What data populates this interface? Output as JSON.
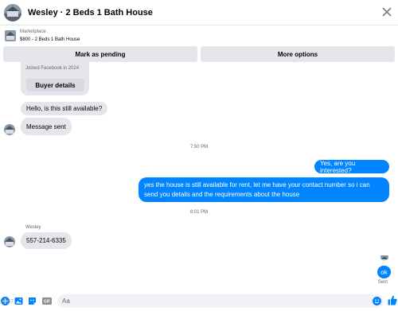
{
  "header": {
    "title": "Wesley · 2 Beds 1 Bath House",
    "close_icon": "close-icon"
  },
  "listing": {
    "source": "Marketplace",
    "price_title": "$800 - 2 Beds 1 Bath House"
  },
  "actions": {
    "mark_pending": "Mark as pending",
    "more_options": "More options"
  },
  "thread": {
    "profile_card": {
      "joined": "Joined Facebook in 2024",
      "buyer_details": "Buyer details"
    },
    "messages": [
      {
        "from": "buyer",
        "text": "Hello, is this still available?"
      },
      {
        "from": "buyer",
        "text": "Message sent"
      },
      {
        "from": "time",
        "text": "7:50 PM"
      },
      {
        "from": "me",
        "text": "Yes, are you interested?"
      },
      {
        "from": "me",
        "text": "yes the house is still available for rent, let me have your contact number so i can send you details and the requirements about the house"
      },
      {
        "from": "time",
        "text": "8:01 PM"
      },
      {
        "from": "buyer",
        "sender": "Wesley",
        "text": "557-214-6335"
      },
      {
        "from": "me",
        "text": "ok",
        "status": "Sent"
      }
    ]
  },
  "composer": {
    "placeholder": "Aa",
    "counter": "13157",
    "icons": [
      "plus-icon",
      "image-icon",
      "sticker-icon",
      "gif-icon",
      "emoji-icon",
      "like-icon"
    ]
  },
  "colors": {
    "accent": "#0084ff",
    "bubble_gray": "#e4e6eb",
    "secondary_text": "#65676b"
  }
}
